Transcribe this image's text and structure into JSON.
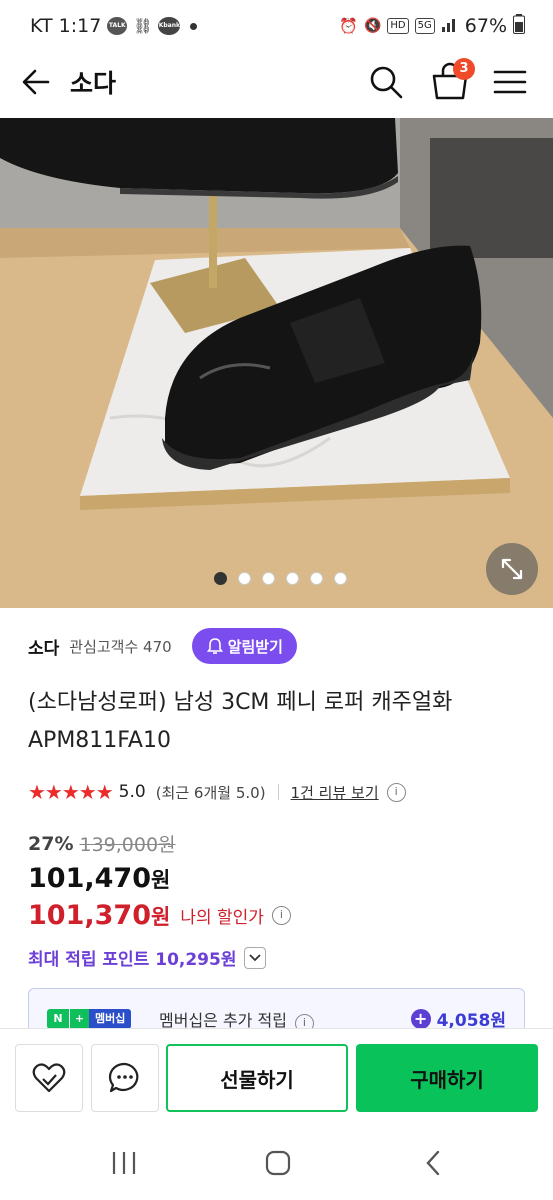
{
  "status_bar": {
    "carrier_time": "KT 1:17",
    "app_badge_1": "TALK",
    "app_badge_2": "Kbank",
    "hd": "HD",
    "network": "5G",
    "battery": "67%"
  },
  "header": {
    "title": "소다",
    "cart_count": "3",
    "icons": [
      "back-arrow-icon",
      "search-icon",
      "cart-icon",
      "menu-icon"
    ]
  },
  "gallery": {
    "slide_count": 6,
    "active_index": 0
  },
  "store": {
    "name": "소다",
    "fans_label": "관심고객수 470",
    "alarm_button": "알림받기"
  },
  "product": {
    "title_line1": "(소다남성로퍼) 남성 3CM 페니 로퍼 캐주얼화",
    "title_line2": "APM811FA10",
    "stars": "★★★★★",
    "rating": "5.0",
    "recent_rating": "(최근 6개월 5.0)",
    "review_link": "1건 리뷰 보기",
    "discount_rate": "27%",
    "original_price": "139,000원",
    "price_number": "101,470",
    "price_unit": "원",
    "my_price_number": "101,370",
    "my_price_unit": "원",
    "my_price_label": "나의 할인가",
    "max_points": "최대 적립 포인트 10,295원"
  },
  "membership": {
    "badge_n": "N",
    "badge_plus": "+",
    "badge_label": "멤버십",
    "text": "멤버십은 추가 적립",
    "points": "4,058원"
  },
  "actions": {
    "gift_button": "선물하기",
    "buy_button": "구매하기"
  },
  "colors": {
    "accent_green": "#0ac25a",
    "purple": "#7b4dee",
    "price_red": "#d0202c",
    "star_red": "#ea2c2c"
  }
}
